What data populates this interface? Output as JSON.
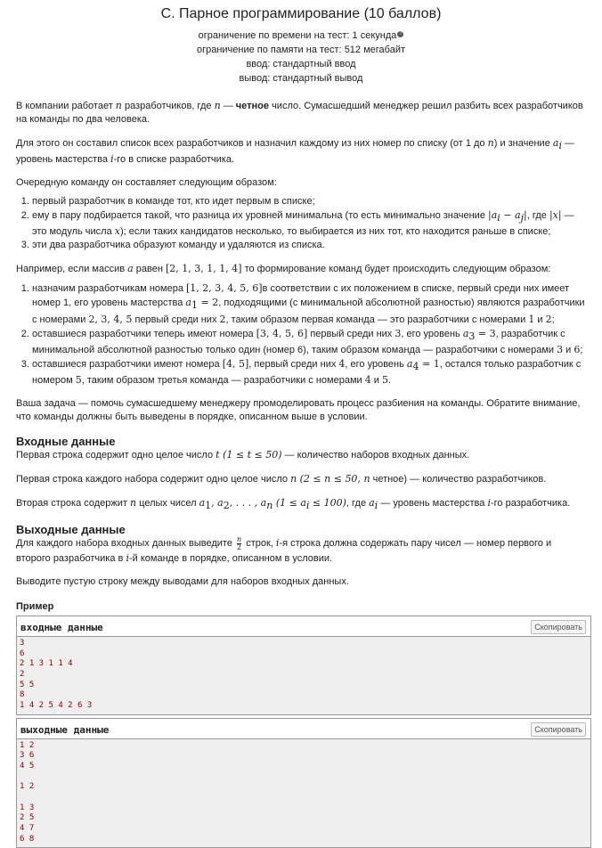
{
  "header": {
    "title": "C. Парное программирование (10 баллов)",
    "time_limit": "ограничение по времени на тест: 1 секунда",
    "memory_limit": "ограничение по памяти на тест: 512 мегабайт",
    "input": "ввод: стандартный ввод",
    "output": "вывод: стандартный вывод",
    "help_icon": "help-circle-icon"
  },
  "legend": {
    "p1": {
      "a": "В компании работает ",
      "n": "n",
      "b": " разработчиков, где ",
      "n2": "n",
      "c": " — ",
      "bold": "четное",
      "d": " число. Сумасшедший менеджер решил разбить всех разработчиков на команды по два человека."
    },
    "p2": {
      "a": "Для этого он составил список всех разработчиков и назначил каждому из них номер по списку (от 1 до ",
      "n": "n",
      "b": ") и значение ",
      "ai": "a",
      "sub": "i",
      "c": " — уровень мастерства ",
      "i": "i",
      "d": "-го в списке разработчика."
    },
    "p3": "Очередную команду он составляет следующим образом:",
    "rules": [
      "первый разработчик в команде тот, кто идет первым в списке;",
      "ему в пару подбирается такой, что разница их уровней минимальна (то есть минимально значение |a_i − a_j|, где |x| — это модуль числа x); если таких кандидатов несколько, то выбирается из них тот, кто находится раньше в списке;",
      "эти два разработчика образуют команду и удаляются из списка."
    ],
    "rule2": {
      "a": "ему в пару подбирается такой, что разница их уровней минимальна (то есть минимально значение ",
      "abs": "|a",
      "si": "i",
      "minus": " − a",
      "sj": "j",
      "abs2": "|",
      "b": ", где ",
      "x": "|x|",
      "c": " — это модуль числа ",
      "xx": "x",
      "d": "); если таких кандидатов несколько, то выбирается из них тот, кто находится раньше в списке;"
    },
    "p4": {
      "a": "Например, если массив ",
      "arr": "a",
      "b": " равен ",
      "vals": "[2, 1, 3, 1, 1, 4]",
      "c": " то формирование команд будет происходить следующим образом:"
    },
    "steps": {
      "s1": {
        "a": "назначим разработчикам номера ",
        "nums": "[1, 2, 3, 4, 5, 6]",
        "b": "в соответствии с их положением в списке, первый среди них имеет номер 1, его уровень мастерства ",
        "eq": "a",
        "sub": "1",
        "eq2": " = 2",
        "c": ", подходящими (с минимальной абсолютной разностью) являются разработчики с номерами ",
        "cand": "2, 3, 4, 5",
        "d": " первый среди них ",
        "two": "2",
        "e": ", таким образом первая команда — это разработчики с номерами ",
        "t1": "1",
        "f": " и ",
        "t2": "2",
        "g": ";"
      },
      "s2": {
        "a": "оставшиеся разработчики теперь имеют номера ",
        "nums": "[3, 4, 5, 6]",
        "b": " первый среди них ",
        "three": "3",
        "c": ", его уровень ",
        "eq": "a",
        "sub": "3",
        "eq2": " = 3",
        "d": ", разработчик с минимальной абсолютной разностью только один (номер 6), таким образом команда — разработчики с номерами ",
        "t1": "3",
        "e": " и ",
        "t2": "6",
        "f": ";"
      },
      "s3": {
        "a": "оставшиеся разработчики имеют номера ",
        "nums": "[4, 5]",
        "b": ", первый среди них ",
        "four": "4",
        "c": ", его уровень ",
        "eq": "a",
        "sub": "4",
        "eq2": " = 1",
        "d": ", остался только разработчик с номером ",
        "five": "5",
        "e": ", таким образом третья команда — разработчики с номерами ",
        "t1": "4",
        "f": " и ",
        "t2": "5",
        "g": "."
      }
    },
    "p5": "Ваша задача — помочь сумасшедшему менеджеру промоделировать процесс разбиения на команды. Обратите внимание, что команды должны быть выведены в порядке, описанном выше в условии."
  },
  "input_spec": {
    "title": "Входные данные",
    "l1": {
      "a": "Первая строка содержит одно целое число ",
      "t": "t (1 ≤ t ≤ 50)",
      "b": " — количество наборов входных данных."
    },
    "l2": {
      "a": "Первая строка каждого набора содержит одно целое число ",
      "n": "n (2 ≤ n ≤ 50, ",
      "b": "n",
      "c": " четное) — количество разработчиков."
    },
    "l3": {
      "a": "Вторая строка содержит ",
      "n": "n",
      "b": " целых чисел ",
      "seq": "a",
      "s1": "1",
      "c2": ", a",
      "s2": "2",
      "dots": ", . . . , a",
      "sn": "n",
      "cond": " (1 ≤ a",
      "si": "i",
      "cond2": " ≤ 100)",
      "c": ", где ",
      "ai": "a",
      "sub": "i",
      "d": " — уровень мастерства ",
      "i": "i",
      "e": "-го разработчика."
    }
  },
  "output_spec": {
    "title": "Выходные данные",
    "l1": {
      "a": "Для каждого набора входных данных выведите ",
      "num": "n",
      "den": "2",
      "b": " строк, ",
      "i": "i",
      "c": "-я строка должна содержать пару чисел — номер первого и второго разработчика в ",
      "i2": "i",
      "d": "-й команде в порядке, описанном в условии."
    },
    "l2": "Выводите пустую строку между выводами для наборов входных данных."
  },
  "example": {
    "title": "Пример",
    "input_label": "входные данные",
    "output_label": "выходные данные",
    "copy_label": "Скопировать",
    "input_text": "3\n6\n2 1 3 1 1 4\n2\n5 5\n8\n1 4 2 5 4 2 6 3",
    "output_text": "1 2\n3 6\n4 5\n\n1 2\n\n1 3\n2 5\n4 7\n6 8"
  }
}
